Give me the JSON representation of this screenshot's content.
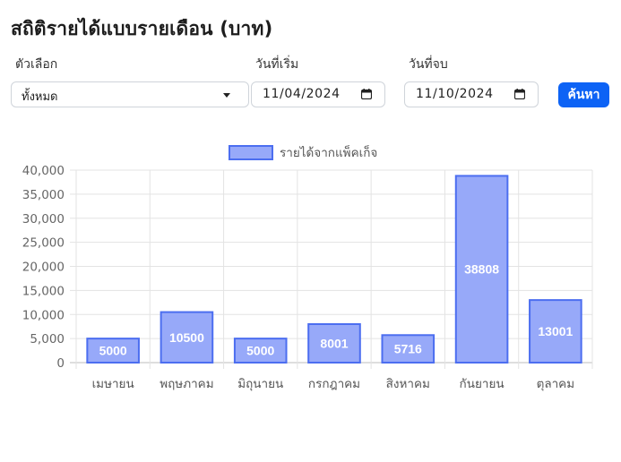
{
  "page": {
    "title": "สถิติรายได้แบบรายเดือน (บาท)"
  },
  "filters": {
    "option_label": "ตัวเลือก",
    "option_value": "ทั้งหมด",
    "start_label": "วันที่เริ่ม",
    "start_value": "11/04/2024",
    "end_label": "วันที่จบ",
    "end_value": "11/10/2024",
    "search_label": "ค้นหา"
  },
  "colors": {
    "bar_fill": "#97a9f9",
    "bar_border": "#4c6ef0",
    "button": "#0d63f5"
  },
  "icons": {
    "calendar": "calendar-icon",
    "caret": "chevron-down-icon"
  },
  "chart_data": {
    "type": "bar",
    "categories": [
      "เมษายน",
      "พฤษภาคม",
      "มิถุนายน",
      "กรกฎาคม",
      "สิงหาคม",
      "กันยายน",
      "ตุลาคม"
    ],
    "series": [
      {
        "name": "รายได้จากแพ็คเก็จ",
        "values": [
          5000,
          10500,
          5000,
          8001,
          5716,
          38808,
          13001
        ]
      }
    ],
    "ylim": [
      0,
      40000
    ],
    "yticks": [
      "0",
      "5,000",
      "10,000",
      "15,000",
      "20,000",
      "25,000",
      "30,000",
      "35,000",
      "40,000"
    ],
    "legend": "top-center",
    "grid": true
  }
}
